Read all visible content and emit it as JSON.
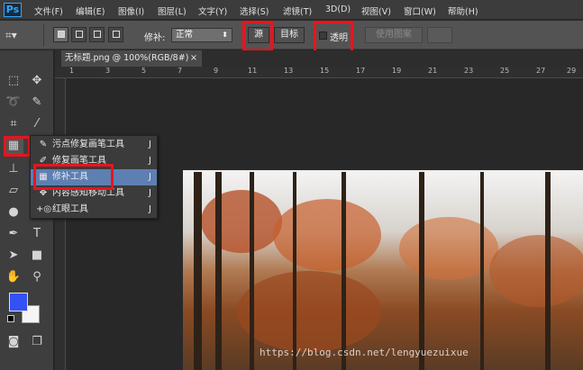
{
  "app": {
    "logo": "Ps"
  },
  "menubar": {
    "items": [
      "文件(F)",
      "编辑(E)",
      "图像(I)",
      "图层(L)",
      "文字(Y)",
      "选择(S)",
      "滤镜(T)",
      "3D(D)",
      "视图(V)",
      "窗口(W)",
      "帮助(H)"
    ]
  },
  "options": {
    "patch_label": "修补:",
    "patch_mode": "正常",
    "source_label": "源",
    "target_label": "目标",
    "transparent_label": "透明",
    "use_pattern_label": "使用图案"
  },
  "document": {
    "tab_title": "无标题.png @ 100%(RGB/8#)",
    "close": "×"
  },
  "ruler": {
    "numbers": [
      "1",
      "3",
      "5",
      "7",
      "9",
      "11",
      "13",
      "15",
      "17",
      "19",
      "21",
      "23",
      "25",
      "27",
      "29"
    ]
  },
  "flyout": {
    "items": [
      {
        "label": "污点修复画笔工具",
        "key": "J",
        "icon": "spot-healing-brush-icon"
      },
      {
        "label": "修复画笔工具",
        "key": "J",
        "icon": "healing-brush-icon"
      },
      {
        "label": "修补工具",
        "key": "J",
        "icon": "patch-tool-icon"
      },
      {
        "label": "内容感知移动工具",
        "key": "J",
        "icon": "content-aware-move-icon"
      },
      {
        "label": "红眼工具",
        "key": "J",
        "icon": "red-eye-icon"
      }
    ]
  },
  "colors": {
    "foreground": "#3451f5",
    "background": "#f4f4f4",
    "highlight": "#e8141e",
    "menu_selected": "#5e7fb2"
  },
  "watermark": "https://blog.csdn.net/lengyuezuixue"
}
